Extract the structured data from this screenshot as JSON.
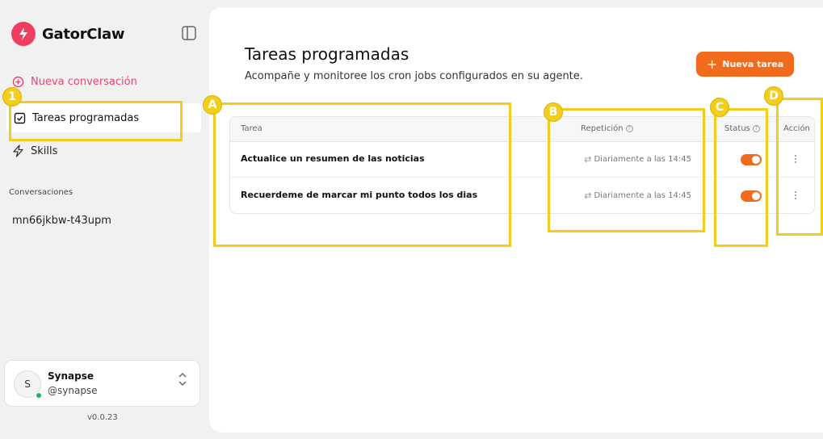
{
  "brand": {
    "name": "GatorClaw"
  },
  "sidebar": {
    "new_conversation": "Nueva conversación",
    "items": [
      {
        "label": "Tareas programadas"
      },
      {
        "label": "Skills"
      }
    ],
    "conversations_heading": "Conversaciones",
    "conversations": [
      "mn66jkbw-t43upm"
    ]
  },
  "user": {
    "initial": "S",
    "name": "Synapse",
    "handle": "@synapse",
    "status": "online"
  },
  "version": "v0.0.23",
  "main": {
    "title": "Tareas programadas",
    "subtitle": "Acompañe y monitoree los cron jobs configurados en su agente.",
    "new_task_button": "Nueva tarea",
    "table": {
      "headers": {
        "task": "Tarea",
        "repeat": "Repetición",
        "status": "Status",
        "action": "Acción"
      },
      "rows": [
        {
          "task": "Actualice un resumen de las noticias",
          "repeat": "Diariamente a las 14:45",
          "enabled": true
        },
        {
          "task": "Recuerdeme de marcar mi punto todos los dias",
          "repeat": "Diariamente a las 14:45",
          "enabled": true
        }
      ]
    }
  },
  "annotations": {
    "labels": [
      "1",
      "A",
      "B",
      "C",
      "D"
    ]
  },
  "colors": {
    "accent": "#f26b1d",
    "brand": "#ef3f60",
    "highlight": "#f2cd19",
    "online": "#22b35e"
  }
}
